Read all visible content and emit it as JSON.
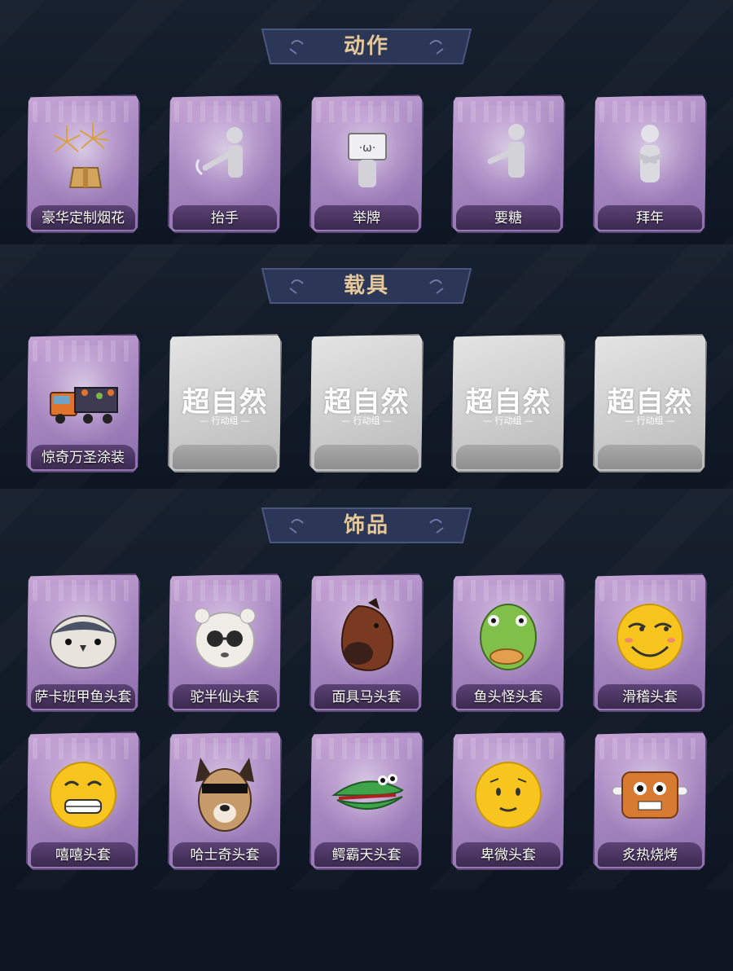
{
  "sections": [
    {
      "title": "动作"
    },
    {
      "title": "载具"
    },
    {
      "title": "饰品"
    }
  ],
  "actions": [
    {
      "label": "豪华定制烟花",
      "icon": "fireworks-box-icon"
    },
    {
      "label": "抬手",
      "icon": "raise-hand-pose-icon"
    },
    {
      "label": "举牌",
      "icon": "hold-sign-pose-icon"
    },
    {
      "label": "要糖",
      "icon": "ask-candy-pose-icon"
    },
    {
      "label": "拜年",
      "icon": "new-year-greeting-pose-icon"
    }
  ],
  "vehicles": [
    {
      "label": "惊奇万圣涂装",
      "icon": "halloween-truck-icon"
    }
  ],
  "locked_placeholder": {
    "logo": "超自然",
    "sub": "— 行动组 —"
  },
  "accessories": [
    {
      "label": "萨卡班甲鱼头套",
      "icon": "fish-head-mask-icon"
    },
    {
      "label": "驼半仙头套",
      "icon": "alpaca-sunglasses-mask-icon"
    },
    {
      "label": "面具马头套",
      "icon": "horse-mask-icon"
    },
    {
      "label": "鱼头怪头套",
      "icon": "green-fish-mask-icon"
    },
    {
      "label": "滑稽头套",
      "icon": "funny-face-mask-icon"
    },
    {
      "label": "嘻嘻头套",
      "icon": "grin-emoji-mask-icon"
    },
    {
      "label": "哈士奇头套",
      "icon": "husky-sunglasses-mask-icon"
    },
    {
      "label": "鳄霸天头套",
      "icon": "crocodile-mask-icon"
    },
    {
      "label": "卑微头套",
      "icon": "humble-emoji-mask-icon"
    },
    {
      "label": "炙热烧烤",
      "icon": "roast-meat-mask-icon"
    }
  ]
}
